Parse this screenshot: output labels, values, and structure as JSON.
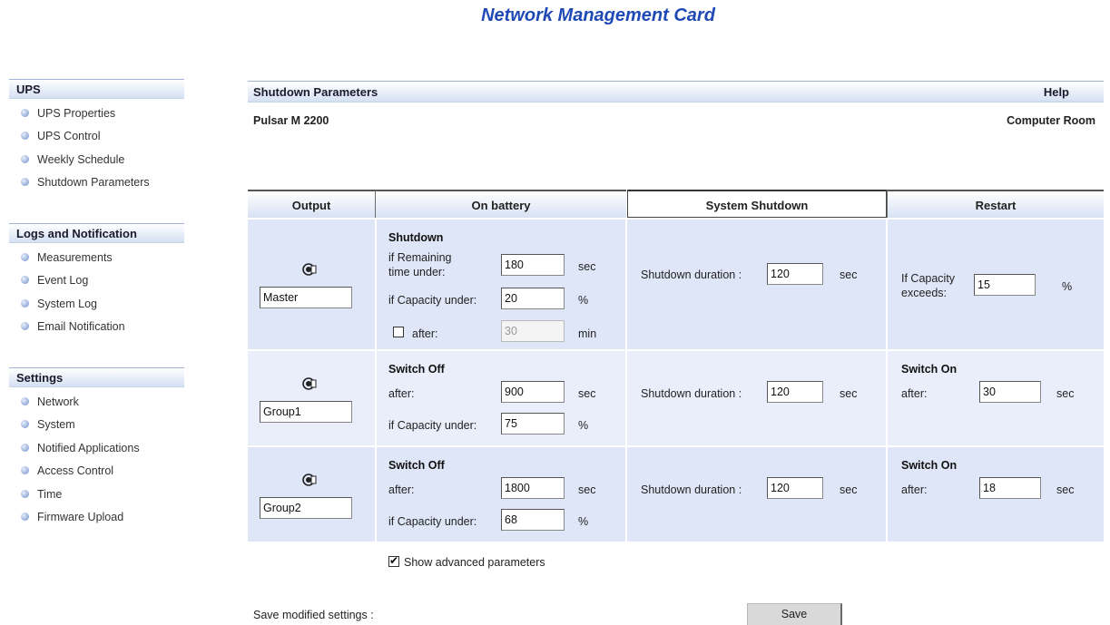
{
  "app_title": "Network Management Card",
  "sidebar": {
    "sections": [
      {
        "title": "UPS",
        "items": [
          "UPS Properties",
          "UPS Control",
          "Weekly Schedule",
          "Shutdown Parameters"
        ]
      },
      {
        "title": "Logs and Notification",
        "items": [
          "Measurements",
          "Event Log",
          "System Log",
          "Email Notification"
        ]
      },
      {
        "title": "Settings",
        "items": [
          "Network",
          "System",
          "Notified Applications",
          "Access Control",
          "Time",
          "Firmware Upload"
        ]
      }
    ]
  },
  "page": {
    "title": "Shutdown Parameters",
    "help": "Help",
    "device": "Pulsar M 2200",
    "location": "Computer Room"
  },
  "table": {
    "headers": [
      "Output",
      "On battery",
      "System Shutdown",
      "Restart"
    ],
    "master": {
      "output_name": "Master",
      "shutdown_title": "Shutdown",
      "remaining_label_1": "if Remaining",
      "remaining_label_2": "time under:",
      "remaining_value": "180",
      "remaining_unit": "sec",
      "capacity_label": "if Capacity under:",
      "capacity_value": "20",
      "capacity_unit": "%",
      "after_label": "after:",
      "after_checked": false,
      "after_value": "30",
      "after_unit": "min",
      "sys_label": "Shutdown duration :",
      "sys_value": "120",
      "sys_unit": "sec",
      "restart_label_1": "If Capacity",
      "restart_label_2": "exceeds:",
      "restart_value": "15",
      "restart_unit": "%"
    },
    "groups": [
      {
        "output_name": "Group1",
        "switch_off_title": "Switch Off",
        "after_label": "after:",
        "after_value": "900",
        "after_unit": "sec",
        "capacity_label": "if Capacity under:",
        "capacity_value": "75",
        "capacity_unit": "%",
        "sys_label": "Shutdown duration :",
        "sys_value": "120",
        "sys_unit": "sec",
        "switch_on_title": "Switch On",
        "on_after_label": "after:",
        "on_after_value": "30",
        "on_after_unit": "sec"
      },
      {
        "output_name": "Group2",
        "switch_off_title": "Switch Off",
        "after_label": "after:",
        "after_value": "1800",
        "after_unit": "sec",
        "capacity_label": "if Capacity under:",
        "capacity_value": "68",
        "capacity_unit": "%",
        "sys_label": "Shutdown duration :",
        "sys_value": "120",
        "sys_unit": "sec",
        "switch_on_title": "Switch On",
        "on_after_label": "after:",
        "on_after_value": "18",
        "on_after_unit": "sec"
      }
    ]
  },
  "advanced": {
    "label": "Show advanced parameters",
    "checked": true
  },
  "save": {
    "label": "Save modified settings :",
    "button": "Save"
  },
  "icons": {
    "sidebar_bullet": "bullet-icon",
    "output": "output-icon"
  },
  "colors": {
    "title": "#1f49b5",
    "header_gradient_end": "#d4e0f2",
    "row_a": "#dfe6f7",
    "row_b": "#eaeefb"
  }
}
